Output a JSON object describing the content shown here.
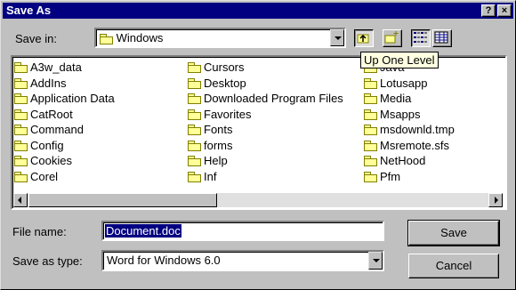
{
  "title": "Save As",
  "title_buttons": {
    "help": "?",
    "close": "×"
  },
  "save_in": {
    "label": "Save in:",
    "value": "Windows"
  },
  "toolbar": {
    "tooltip": "Up One Level"
  },
  "files": {
    "col1": [
      "A3w_data",
      "AddIns",
      "Application Data",
      "CatRoot",
      "Command",
      "Config",
      "Cookies",
      "Corel"
    ],
    "col2": [
      "Cursors",
      "Desktop",
      "Downloaded Program Files",
      "Favorites",
      "Fonts",
      "forms",
      "Help",
      "Inf"
    ],
    "col3": [
      "Java",
      "Lotusapp",
      "Media",
      "Msapps",
      "msdownld.tmp",
      "Msremote.sfs",
      "NetHood",
      "Pfm"
    ]
  },
  "file_name": {
    "label": "File name:",
    "value": "Document.doc"
  },
  "save_as_type": {
    "label": "Save as type:",
    "value": "Word for Windows 6.0"
  },
  "buttons": {
    "save": "Save",
    "cancel": "Cancel"
  }
}
